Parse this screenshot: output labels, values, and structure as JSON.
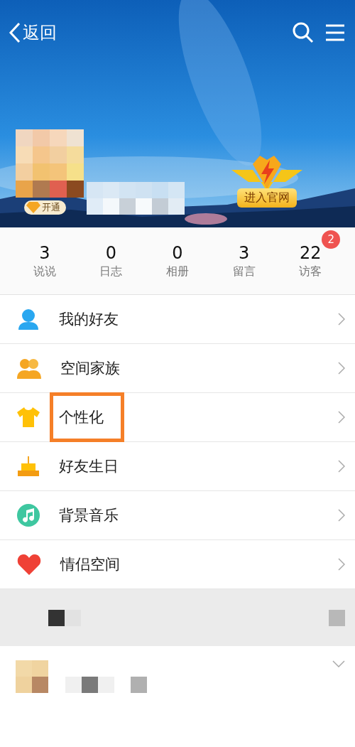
{
  "header": {
    "back_label": "返回",
    "vip_badge": "开通",
    "official_site_badge": "进入官网"
  },
  "stats": [
    {
      "value": "3",
      "label": "说说"
    },
    {
      "value": "0",
      "label": "日志"
    },
    {
      "value": "0",
      "label": "相册"
    },
    {
      "value": "3",
      "label": "留言"
    },
    {
      "value": "22",
      "label": "访客",
      "badge": "2"
    }
  ],
  "menu": [
    {
      "label": "我的好友",
      "kind": "friend",
      "highlighted": false
    },
    {
      "label": "空间家族",
      "kind": "family",
      "highlighted": false
    },
    {
      "label": "个性化",
      "kind": "shirt",
      "highlighted": true
    },
    {
      "label": "好友生日",
      "kind": "cake",
      "highlighted": false
    },
    {
      "label": "背景音乐",
      "kind": "music",
      "highlighted": false
    },
    {
      "label": "情侣空间",
      "kind": "heart",
      "highlighted": false
    }
  ]
}
